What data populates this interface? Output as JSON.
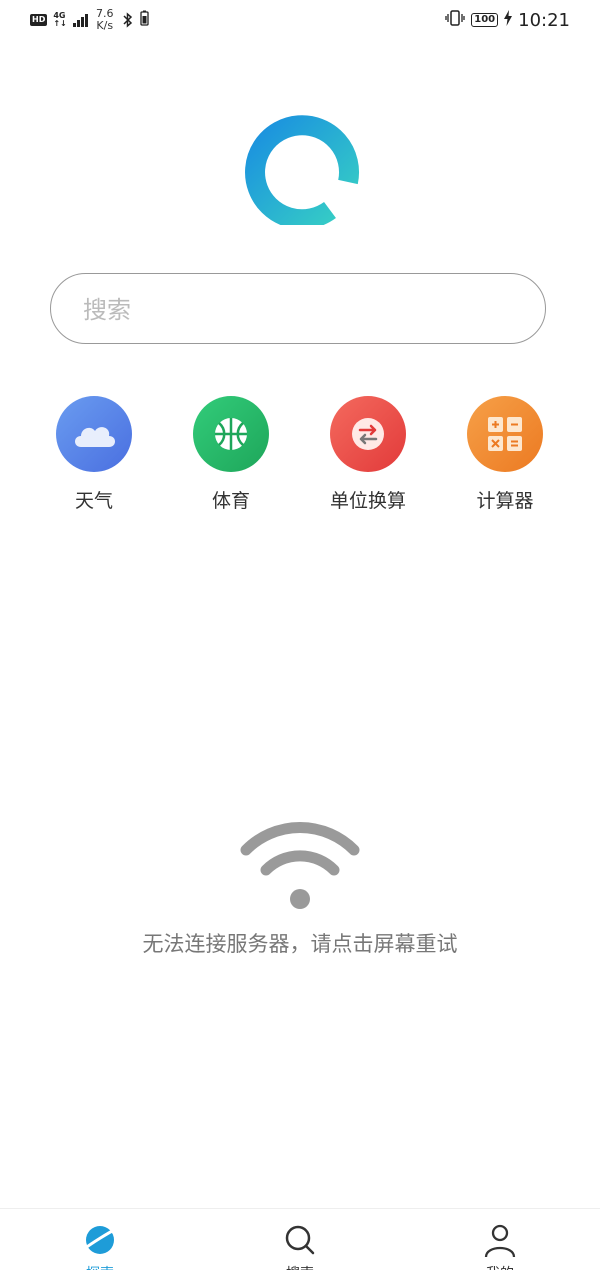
{
  "status_bar": {
    "hd": "HD",
    "network_type_top": "4G",
    "network_type_bottom": "↑↓",
    "speed_value": "7.6",
    "speed_unit": "K/s",
    "battery": "100",
    "time": "10:21"
  },
  "search": {
    "placeholder": "搜索",
    "value": ""
  },
  "tools": [
    {
      "label": "天气",
      "icon": "cloud-icon",
      "color": "#5a8fe8"
    },
    {
      "label": "体育",
      "icon": "basketball-icon",
      "color": "#27b868"
    },
    {
      "label": "单位换算",
      "icon": "swap-arrows-icon",
      "color": "#ef4c4c"
    },
    {
      "label": "计算器",
      "icon": "calculator-icon",
      "color": "#f08a2e"
    }
  ],
  "error": {
    "message": "无法连接服务器，请点击屏幕重试",
    "icon": "wifi-icon"
  },
  "bottom_nav": [
    {
      "label": "探索",
      "icon": "planet-icon",
      "active": true
    },
    {
      "label": "搜索",
      "icon": "search-icon",
      "active": false
    },
    {
      "label": "我的",
      "icon": "user-icon",
      "active": false
    }
  ],
  "colors": {
    "accent": "#1e9cd8",
    "logo_gradient_start": "#1a8fe0",
    "logo_gradient_end": "#37d0c4"
  }
}
